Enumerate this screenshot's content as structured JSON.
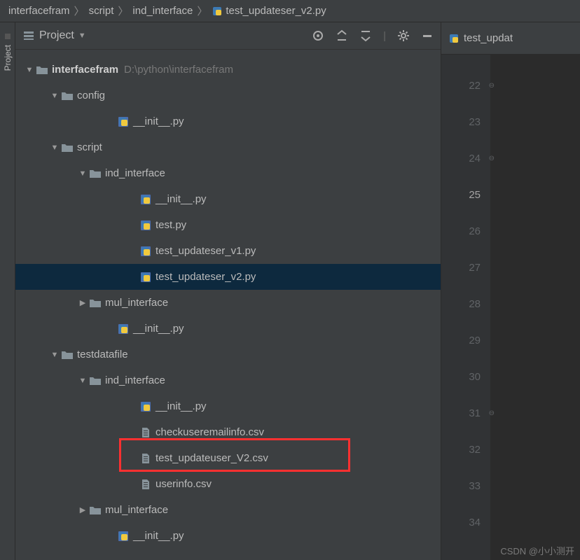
{
  "breadcrumb": {
    "items": [
      "interfacefram",
      "script",
      "ind_interface",
      "test_updateser_v2.py"
    ]
  },
  "panel": {
    "title": "Project"
  },
  "sidebar": {
    "label": "Project"
  },
  "tree": [
    {
      "indent": 0,
      "arrow": "down",
      "icon": "folder",
      "label": "interfacefram",
      "bold": true,
      "hint": "D:\\python\\interfacefram"
    },
    {
      "indent": 1,
      "arrow": "down",
      "icon": "folder",
      "label": "config"
    },
    {
      "indent": 3,
      "arrow": "none",
      "icon": "py",
      "label": "__init__.py"
    },
    {
      "indent": 1,
      "arrow": "down",
      "icon": "folder",
      "label": "script"
    },
    {
      "indent": 2,
      "arrow": "down",
      "icon": "folder",
      "label": "ind_interface"
    },
    {
      "indent": 3,
      "arrow": "none",
      "icon": "py",
      "label": "__init__.py",
      "extraIndent": true
    },
    {
      "indent": 3,
      "arrow": "none",
      "icon": "py",
      "label": "test.py",
      "extraIndent": true
    },
    {
      "indent": 3,
      "arrow": "none",
      "icon": "py",
      "label": "test_updateser_v1.py",
      "extraIndent": true
    },
    {
      "indent": 3,
      "arrow": "none",
      "icon": "py",
      "label": "test_updateser_v2.py",
      "extraIndent": true,
      "selected": true
    },
    {
      "indent": 2,
      "arrow": "right",
      "icon": "folder",
      "label": "mul_interface"
    },
    {
      "indent": 3,
      "arrow": "none",
      "icon": "py",
      "label": "__init__.py"
    },
    {
      "indent": 1,
      "arrow": "down",
      "icon": "folder",
      "label": "testdatafile"
    },
    {
      "indent": 2,
      "arrow": "down",
      "icon": "folder",
      "label": "ind_interface"
    },
    {
      "indent": 3,
      "arrow": "none",
      "icon": "py",
      "label": "__init__.py",
      "extraIndent": true
    },
    {
      "indent": 3,
      "arrow": "none",
      "icon": "file",
      "label": "checkuseremailinfo.csv",
      "extraIndent": true
    },
    {
      "indent": 3,
      "arrow": "none",
      "icon": "file",
      "label": "test_updateuser_V2.csv",
      "extraIndent": true,
      "highlighted": true
    },
    {
      "indent": 3,
      "arrow": "none",
      "icon": "file",
      "label": "userinfo.csv",
      "extraIndent": true
    },
    {
      "indent": 2,
      "arrow": "right",
      "icon": "folder",
      "label": "mul_interface"
    },
    {
      "indent": 3,
      "arrow": "none",
      "icon": "py",
      "label": "__init__.py"
    }
  ],
  "editor": {
    "tab_label": "test_updat",
    "gutter": [
      {
        "n": "22",
        "mark": "collapse"
      },
      {
        "n": "23"
      },
      {
        "n": "24",
        "mark": "collapse"
      },
      {
        "n": "25",
        "current": true
      },
      {
        "n": "26"
      },
      {
        "n": "27"
      },
      {
        "n": "28"
      },
      {
        "n": "29"
      },
      {
        "n": "30"
      },
      {
        "n": "31",
        "mark": "collapse"
      },
      {
        "n": "32"
      },
      {
        "n": "33"
      },
      {
        "n": "34"
      }
    ]
  },
  "watermark": "CSDN @小小测开"
}
